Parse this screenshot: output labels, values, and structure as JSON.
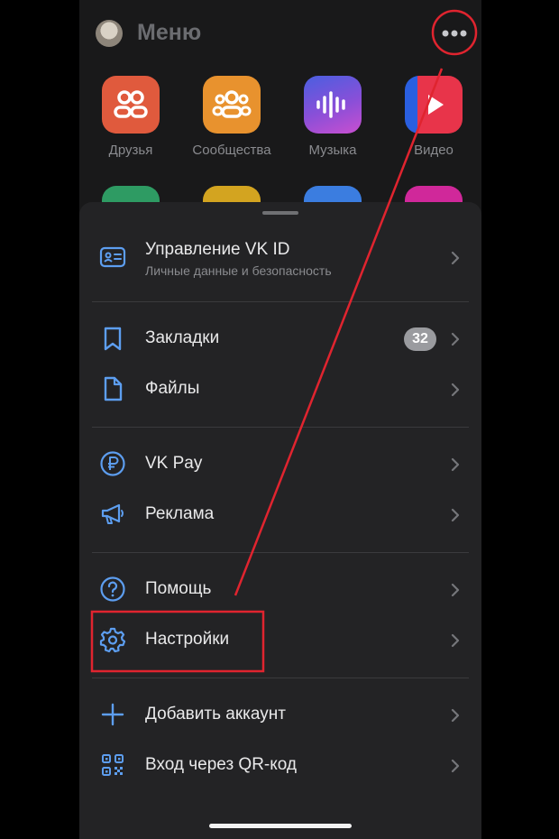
{
  "header": {
    "title": "Меню"
  },
  "apps": [
    {
      "label": "Друзья",
      "color": "#e05a3d",
      "icon": "friends-icon"
    },
    {
      "label": "Сообщества",
      "color": "#e8922e",
      "icon": "communities-icon"
    },
    {
      "label": "Музыка",
      "color": "#7b4fd8",
      "icon": "music-icon"
    },
    {
      "label": "Видео",
      "color": "#e8344a",
      "icon": "video-icon"
    }
  ],
  "menu": {
    "vkid": {
      "label": "Управление VK ID",
      "sub": "Личные данные и безопасность",
      "icon": "id-card-icon"
    },
    "bookmarks": {
      "label": "Закладки",
      "badge": "32",
      "icon": "bookmark-icon"
    },
    "files": {
      "label": "Файлы",
      "icon": "file-icon"
    },
    "vkpay": {
      "label": "VK Pay",
      "icon": "ruble-icon"
    },
    "ads": {
      "label": "Реклама",
      "icon": "megaphone-icon"
    },
    "help": {
      "label": "Помощь",
      "icon": "question-icon"
    },
    "settings": {
      "label": "Настройки",
      "icon": "gear-icon"
    },
    "add_account": {
      "label": "Добавить аккаунт",
      "icon": "plus-icon"
    },
    "qr_login": {
      "label": "Вход через QR-код",
      "icon": "qr-code-icon"
    }
  },
  "colors": {
    "accent": "#5d9ef0",
    "annotation": "#e0242f",
    "background": "#19191a",
    "sheet": "#232325"
  }
}
